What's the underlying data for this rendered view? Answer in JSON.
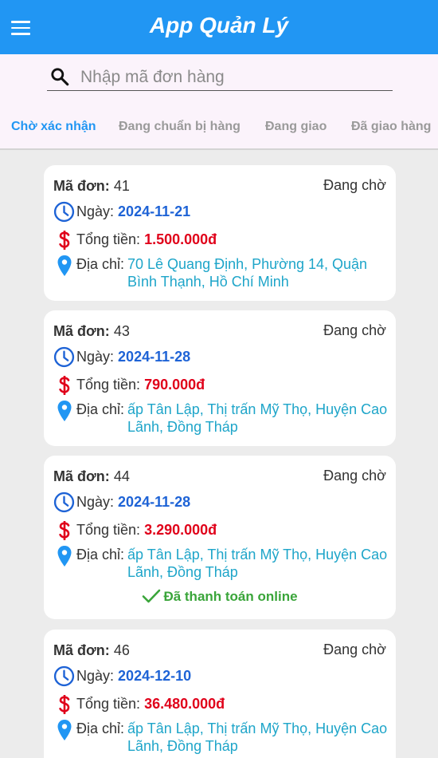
{
  "header": {
    "title": "App Quản Lý"
  },
  "search": {
    "placeholder": "Nhập mã đơn hàng"
  },
  "tabs": [
    {
      "label": "Chờ xác nhận",
      "active": true
    },
    {
      "label": "Đang chuẩn bị hàng",
      "active": false
    },
    {
      "label": "Đang giao",
      "active": false
    },
    {
      "label": "Đã giao hàng",
      "active": false
    }
  ],
  "labels": {
    "order_code": "Mã đơn:",
    "date": "Ngày:",
    "total": "Tổng tiền:",
    "address": "Địa chỉ:"
  },
  "orders": [
    {
      "code": "41",
      "status": "Đang chờ",
      "date": "2024-11-21",
      "total": "1.500.000đ",
      "address": "70 Lê Quang Định, Phường 14, Quận Bình Thạnh, Hồ Chí Minh",
      "paid_note": ""
    },
    {
      "code": "43",
      "status": "Đang chờ",
      "date": "2024-11-28",
      "total": "790.000đ",
      "address": "ấp Tân Lập, Thị trấn Mỹ Thọ, Huyện Cao Lãnh, Đồng Tháp",
      "paid_note": ""
    },
    {
      "code": "44",
      "status": "Đang chờ",
      "date": "2024-11-28",
      "total": "3.290.000đ",
      "address": "ấp Tân Lập, Thị trấn Mỹ Thọ, Huyện Cao Lãnh, Đồng Tháp",
      "paid_note": "Đã thanh toán online"
    },
    {
      "code": "46",
      "status": "Đang chờ",
      "date": "2024-12-10",
      "total": "36.480.000đ",
      "address": "ấp Tân Lập, Thị trấn Mỹ Thọ, Huyện Cao Lãnh, Đồng Tháp",
      "paid_note": ""
    }
  ],
  "colors": {
    "primary": "#2196f3",
    "date": "#1e63d6",
    "money": "#e0001a",
    "address": "#1ea5c9",
    "paid": "#3aa53a"
  },
  "icons": [
    "menu-icon",
    "search-icon",
    "clock-icon",
    "dollar-icon",
    "location-pin-icon",
    "check-icon"
  ]
}
